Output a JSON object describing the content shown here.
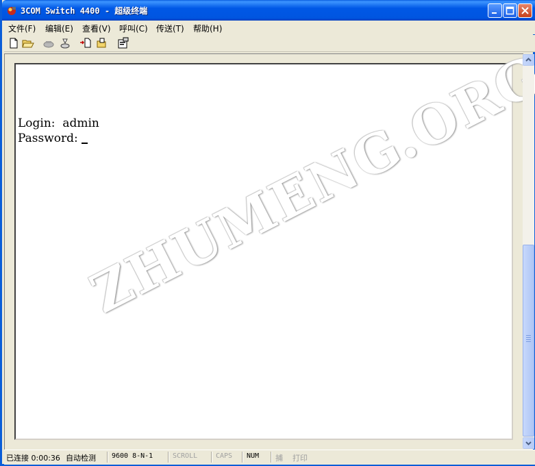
{
  "window": {
    "title": "3COM Switch 4400 - 超级终端",
    "minimize_icon": "minimize-icon",
    "maximize_icon": "maximize-icon",
    "close_icon": "close-icon"
  },
  "menubar": {
    "items": [
      {
        "label": "文件(F)"
      },
      {
        "label": "编辑(E)"
      },
      {
        "label": "查看(V)"
      },
      {
        "label": "呼叫(C)"
      },
      {
        "label": "传送(T)"
      },
      {
        "label": "帮助(H)"
      }
    ]
  },
  "toolbar": {
    "icons": [
      "new-icon",
      "open-icon",
      "dial-icon",
      "disconnect-icon",
      "send-icon",
      "receive-icon",
      "properties-icon"
    ]
  },
  "terminal": {
    "lines": [
      "Login:  admin",
      "Password: "
    ],
    "watermark": "ZHUMENG.ORG"
  },
  "statusbar": {
    "connection": "已连接 0:00:36",
    "detect": "自动检测",
    "port_settings": "9600 8-N-1",
    "scroll": "SCROLL",
    "caps": "CAPS",
    "num": "NUM",
    "capture": "捕",
    "print": "打印"
  },
  "colors": {
    "titlebar": "#0058e6",
    "chrome": "#ece9d8",
    "terminal_bg": "#ffffff",
    "close_button": "#c6401c"
  }
}
